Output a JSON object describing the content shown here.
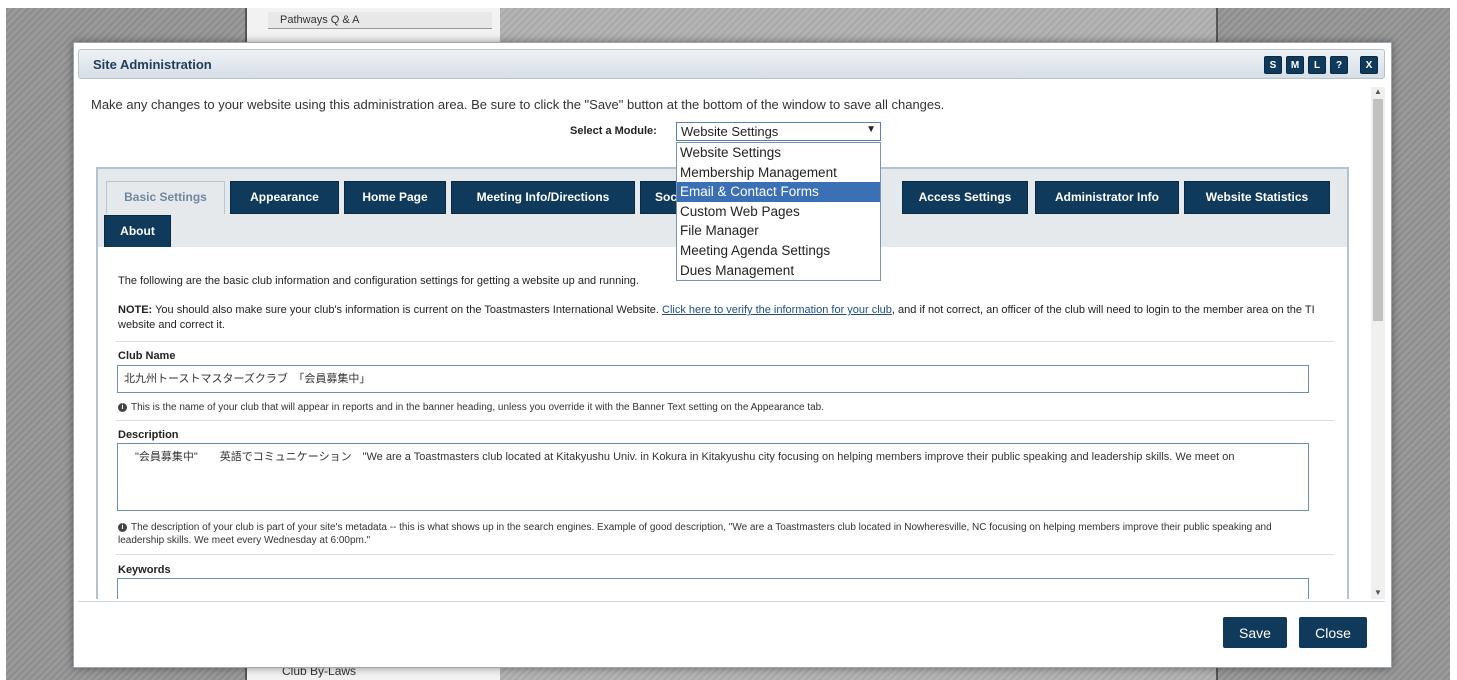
{
  "background": {
    "link_top": "Pathways Q & A",
    "link_bottom": "Club By-Laws"
  },
  "dialog": {
    "title": "Site Administration",
    "title_buttons": [
      "S",
      "M",
      "L",
      "?",
      "X"
    ],
    "intro": "Make any changes to your website using this administration area. Be sure to click the \"Save\" button at the bottom of the window to save all changes.",
    "module": {
      "label": "Select a Module:",
      "selected": "Website Settings",
      "options": [
        "Website Settings",
        "Membership Management",
        "Email & Contact Forms",
        "Custom Web Pages",
        "File Manager",
        "Meeting Agenda Settings",
        "Dues Management"
      ],
      "highlighted_index": 2
    },
    "tabs": [
      "Basic Settings",
      "Appearance",
      "Home Page",
      "Meeting Info/Directions",
      "Soc",
      "Access Settings",
      "Administrator Info",
      "Website Statistics",
      "About"
    ],
    "basic": {
      "intro": "The following are the basic club information and configuration settings for getting a website up and running.",
      "note_label": "NOTE:",
      "note_text": " You should also make sure your club's information is current on the Toastmasters International Website. ",
      "note_link": "Click here to verify the information for your club",
      "note_tail": ", and if not correct, an officer of the club will need to login to the member area on the TI website and correct it.",
      "club_name_label": "Club Name",
      "club_name_value": "北九州トーストマスターズクラブ　「会員募集中」",
      "club_name_hint": "This is the name of your club that will appear in reports and in the banner heading, unless you override it with the Banner Text setting on the Appearance tab.",
      "description_label": "Description",
      "description_value": "　\"会員募集中\"　　英語でコミュニケーション　\"We are a Toastmasters club located at Kitakyushu Univ. in Kokura in Kitakyushu city focusing on helping members improve their public speaking and leadership skills. We meet on",
      "description_hint": "The description of your club is part of your site's metadata -- this is what shows up in the search engines. Example of good description, \"We are a Toastmasters club located in Nowheresville, NC focusing on helping members improve their public speaking and leadership skills. We meet every Wednesday at 6:00pm.\"",
      "keywords_label": "Keywords"
    },
    "footer": {
      "save": "Save",
      "close": "Close"
    }
  },
  "colors": {
    "tab_bg": "#0f3a5c",
    "highlight": "#3b6fb6",
    "link": "#1e4d8c"
  }
}
